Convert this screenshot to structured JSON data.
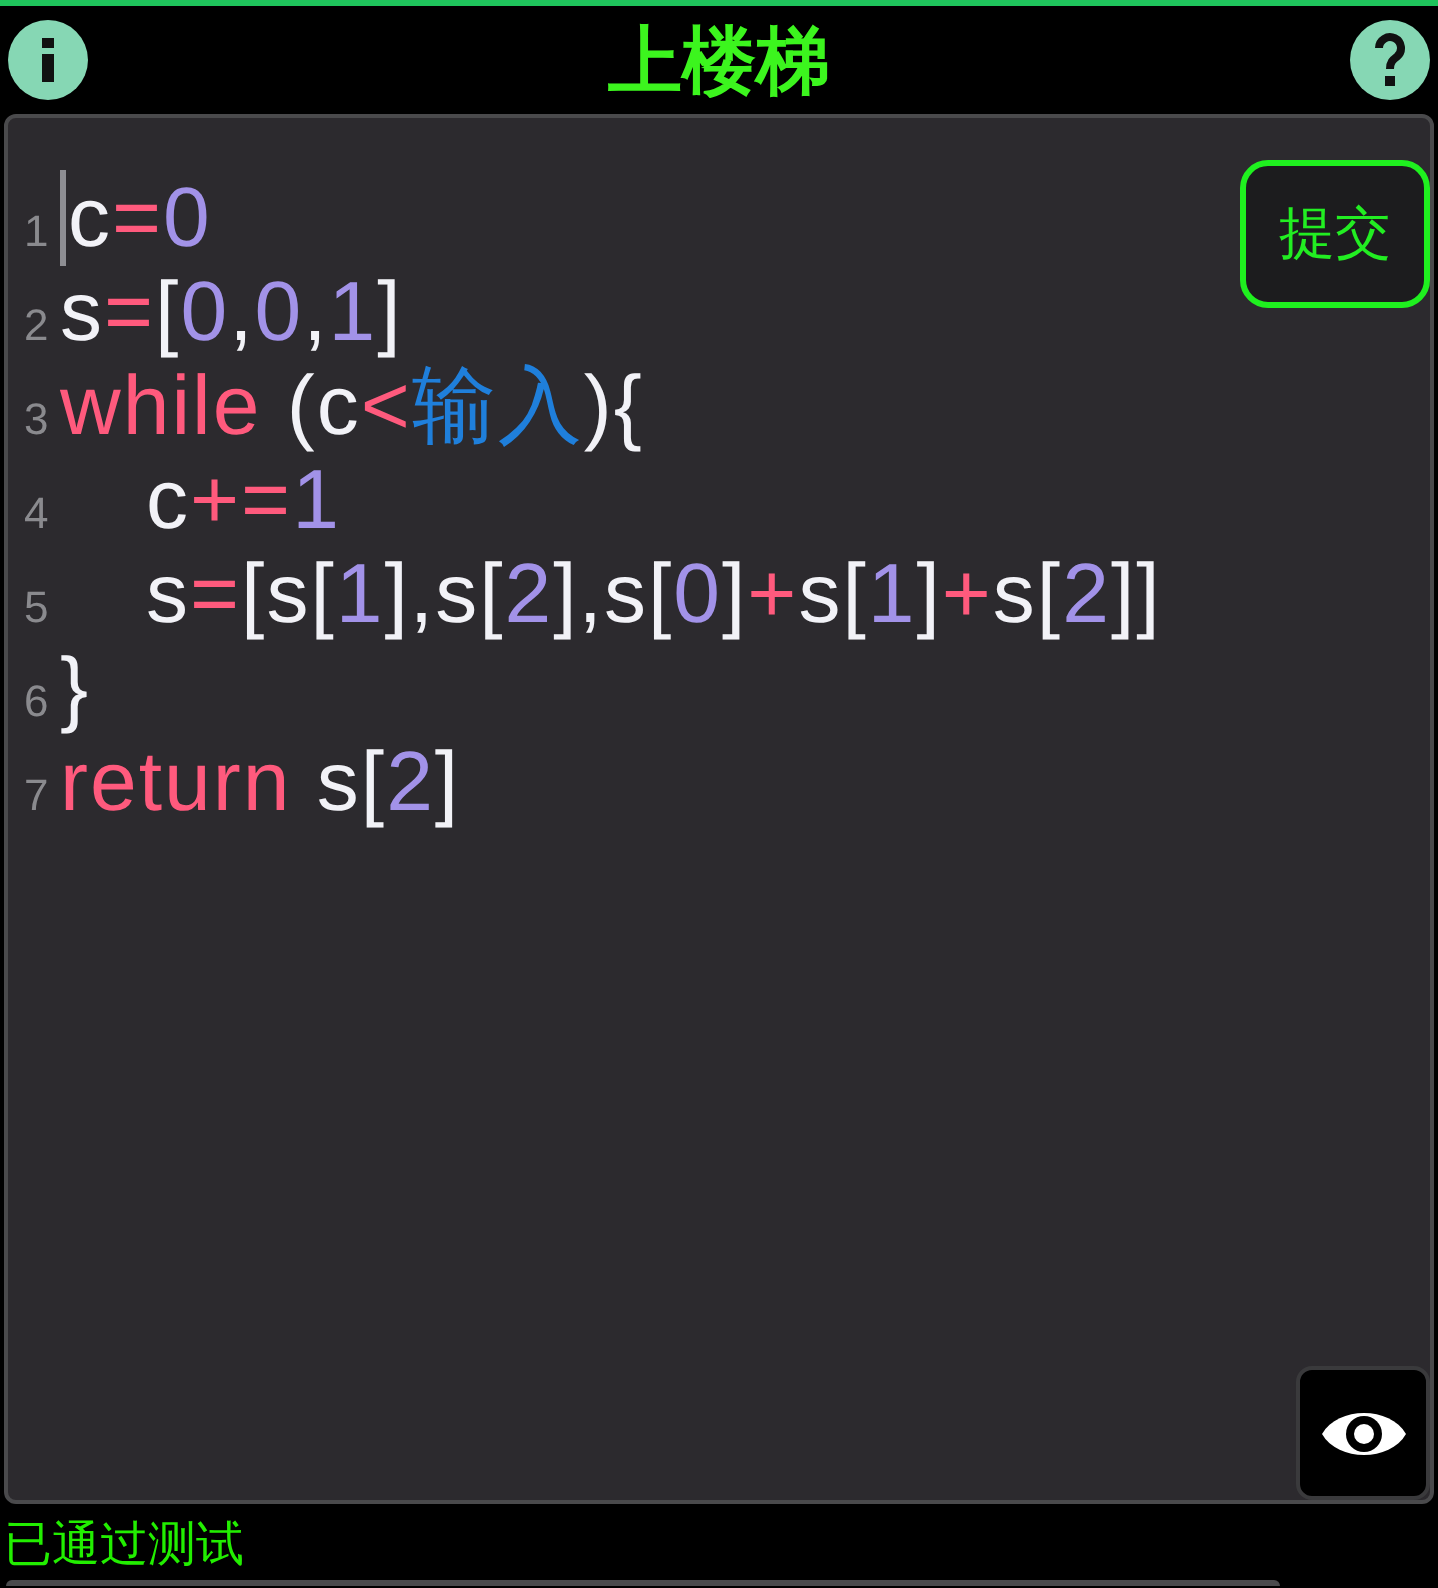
{
  "header": {
    "title": "上楼梯"
  },
  "editor": {
    "lines": [
      {
        "number": "1",
        "cursor": true,
        "tokens": [
          {
            "text": "c",
            "kind": "plain"
          },
          {
            "text": "=",
            "kind": "operator"
          },
          {
            "text": "0",
            "kind": "number"
          }
        ]
      },
      {
        "number": "2",
        "cursor": false,
        "tokens": [
          {
            "text": "s",
            "kind": "plain"
          },
          {
            "text": "=",
            "kind": "operator"
          },
          {
            "text": "[",
            "kind": "plain"
          },
          {
            "text": "0",
            "kind": "number"
          },
          {
            "text": ",",
            "kind": "plain"
          },
          {
            "text": "0",
            "kind": "number"
          },
          {
            "text": ",",
            "kind": "plain"
          },
          {
            "text": "1",
            "kind": "number"
          },
          {
            "text": "]",
            "kind": "plain"
          }
        ]
      },
      {
        "number": "3",
        "cursor": false,
        "tokens": [
          {
            "text": "while",
            "kind": "keyword"
          },
          {
            "text": " (c",
            "kind": "plain"
          },
          {
            "text": "<",
            "kind": "operator"
          },
          {
            "text": "输入",
            "kind": "input"
          },
          {
            "text": "){",
            "kind": "plain"
          }
        ],
        "children": [
          {
            "number": "4",
            "cursor": false,
            "tokens": [
              {
                "text": "c",
                "kind": "plain"
              },
              {
                "text": "+=",
                "kind": "operator"
              },
              {
                "text": "1",
                "kind": "number"
              }
            ]
          },
          {
            "number": "5",
            "cursor": false,
            "tokens": [
              {
                "text": "s",
                "kind": "plain"
              },
              {
                "text": "=",
                "kind": "operator"
              },
              {
                "text": "[s[",
                "kind": "plain"
              },
              {
                "text": "1",
                "kind": "number"
              },
              {
                "text": "],s[",
                "kind": "plain"
              },
              {
                "text": "2",
                "kind": "number"
              },
              {
                "text": "],s[",
                "kind": "plain"
              },
              {
                "text": "0",
                "kind": "number"
              },
              {
                "text": "]",
                "kind": "plain"
              },
              {
                "text": "+",
                "kind": "operator"
              },
              {
                "text": "s[",
                "kind": "plain"
              },
              {
                "text": "1",
                "kind": "number"
              },
              {
                "text": "]",
                "kind": "plain"
              },
              {
                "text": "+",
                "kind": "operator"
              },
              {
                "text": "s[",
                "kind": "plain"
              },
              {
                "text": "2",
                "kind": "number"
              },
              {
                "text": "]]",
                "kind": "plain"
              }
            ]
          }
        ]
      },
      {
        "number": "6",
        "cursor": false,
        "tokens": [
          {
            "text": "}",
            "kind": "plain"
          }
        ]
      },
      {
        "number": "7",
        "cursor": false,
        "tokens": [
          {
            "text": "return",
            "kind": "keyword"
          },
          {
            "text": " s[",
            "kind": "plain"
          },
          {
            "text": "2",
            "kind": "number"
          },
          {
            "text": "]",
            "kind": "plain"
          }
        ]
      }
    ],
    "submit_button": {
      "label": "提交"
    }
  },
  "status": {
    "text": "已通过测试",
    "passed": true
  }
}
